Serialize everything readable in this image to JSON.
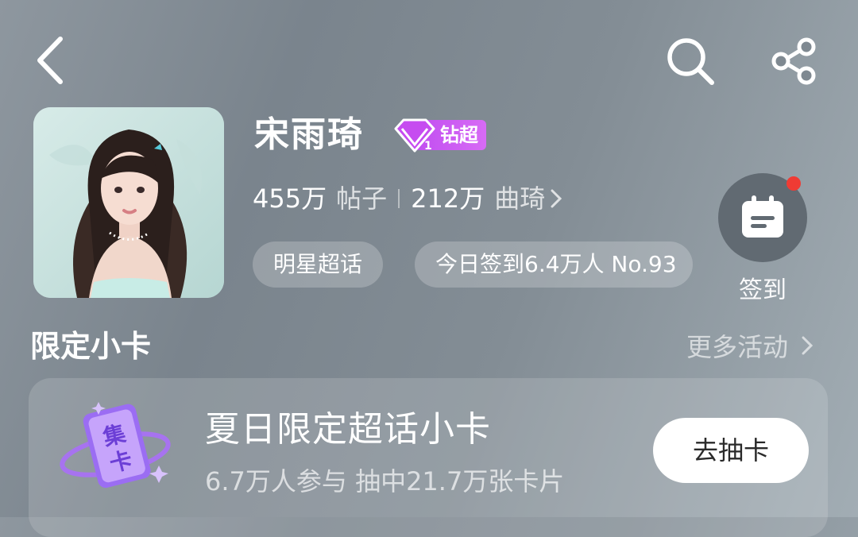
{
  "header": {
    "back_icon": "chevron-left-icon",
    "search_icon": "search-icon",
    "share_icon": "share-icon"
  },
  "profile": {
    "name": "宋雨琦",
    "badge_label": "钻超",
    "badge_level": "1",
    "posts_count": "455万",
    "posts_label": "帖子",
    "fans_count": "212万",
    "fans_label": "曲琦",
    "tag_1": "明星超话",
    "tag_2": "今日签到6.4万人 No.93"
  },
  "checkin": {
    "label": "签到",
    "accent": "#ef3b34"
  },
  "section": {
    "title": "限定小卡",
    "more_link": "更多活动"
  },
  "card": {
    "icon_text_1": "集",
    "icon_text_2": "卡",
    "title": "夏日限定超话小卡",
    "subtitle": "6.7万人参与 抽中21.7万张卡片",
    "button_label": "去抽卡"
  }
}
